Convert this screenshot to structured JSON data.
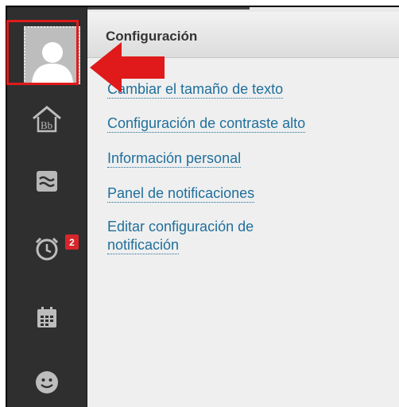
{
  "panel": {
    "title": "Configuración",
    "links": [
      "Cambiar el tamaño de texto",
      "Configuración de contraste alto",
      "Información personal",
      "Panel de notificaciones",
      "Editar configuración de",
      "notificación"
    ]
  },
  "sidebar": {
    "items": [
      {
        "icon": "user-avatar-icon"
      },
      {
        "icon": "bb-home-icon",
        "label": "Bb"
      },
      {
        "icon": "stream-icon"
      },
      {
        "icon": "alarm-clock-icon",
        "badge": "2"
      },
      {
        "icon": "calendar-icon"
      },
      {
        "icon": "smiley-icon"
      }
    ]
  },
  "colors": {
    "sidebar": "#2f2f2f",
    "link": "#1f6f9c",
    "highlight": "#e01a1a",
    "badge": "#d7262c"
  }
}
